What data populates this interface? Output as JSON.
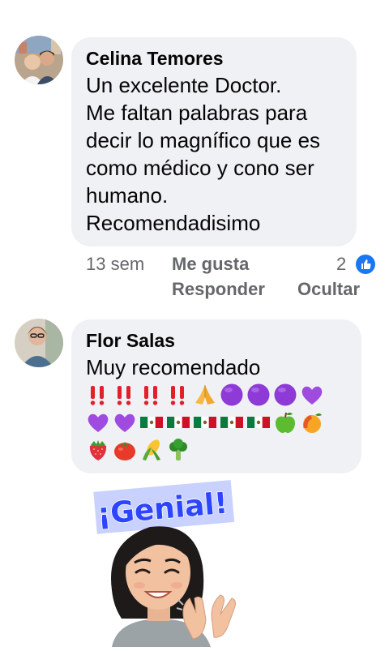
{
  "comments": [
    {
      "author": "Celina Temores",
      "lines": [
        "Un excelente Doctor.",
        "Me faltan palabras para",
        "decir lo magnífico que es",
        "como médico y cono ser",
        "humano.",
        "Recomendadisimo"
      ],
      "time": "13 sem",
      "like_label": "Me gusta",
      "reply_label": "Responder",
      "hide_label": "Ocultar",
      "reaction_count": "2"
    },
    {
      "author": "Flor Salas",
      "lines": [
        "Muy recomendado"
      ],
      "emoji_rows": [
        [
          "double-exclamation",
          "double-exclamation",
          "double-exclamation",
          "double-exclamation",
          "folded-hands",
          "purple-circle",
          "purple-circle",
          "purple-circle",
          "purple-heart"
        ],
        [
          "purple-heart",
          "purple-heart",
          "mexico-flag",
          "mexico-flag",
          "mexico-flag",
          "mexico-flag",
          "mexico-flag",
          "green-apple",
          "mango"
        ],
        [
          "strawberry",
          "tomato",
          "corn",
          "broccoli"
        ]
      ]
    }
  ],
  "sticker": {
    "text": "¡Genial!",
    "description": "avatar-clapping"
  },
  "colors": {
    "bubble": "#f0f1f5",
    "meta": "#65676b",
    "like_blue": "#1877f2",
    "sticker_banner": "#c9d2ff",
    "sticker_text": "#2e45ff"
  }
}
